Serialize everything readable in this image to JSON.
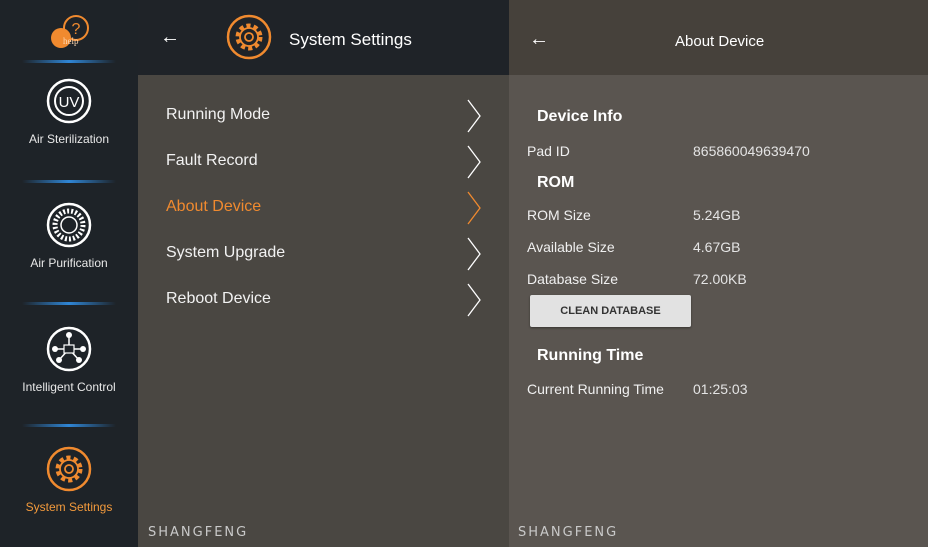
{
  "colors": {
    "accent": "#f08a2f",
    "rail_bg": "#1e2328",
    "mid_bg": "#4a4742",
    "right_bg": "#5a5550",
    "separator": "#2f86d6"
  },
  "rail": {
    "help_icon": "help-question-icon",
    "help_text": "help",
    "items": [
      {
        "label": "Air Sterilization",
        "icon": "uv-icon"
      },
      {
        "label": "Air Purification",
        "icon": "fan-icon"
      },
      {
        "label": "Intelligent Control",
        "icon": "network-icon"
      },
      {
        "label": "System Settings",
        "icon": "gear-icon",
        "active": true
      }
    ]
  },
  "middle": {
    "back_icon": "back-arrow-icon",
    "title": "System Settings",
    "menu": [
      {
        "label": "Running Mode"
      },
      {
        "label": "Fault Record"
      },
      {
        "label": "About Device",
        "active": true
      },
      {
        "label": "System Upgrade"
      },
      {
        "label": "Reboot Device"
      }
    ],
    "brand": "SHANGFENG"
  },
  "detail": {
    "title": "About Device",
    "device_info": {
      "heading": "Device Info",
      "pad_id_label": "Pad ID",
      "pad_id_value": "865860049639470"
    },
    "rom": {
      "heading": "ROM",
      "rom_size_label": "ROM Size",
      "rom_size_value": "5.24GB",
      "available_label": "Available Size",
      "available_value": "4.67GB",
      "database_label": "Database Size",
      "database_value": "72.00KB",
      "clean_button": "CLEAN DATABASE"
    },
    "running_time": {
      "heading": "Running Time",
      "current_label": "Current Running Time",
      "current_value": "01:25:03"
    },
    "brand": "SHANGFENG"
  }
}
